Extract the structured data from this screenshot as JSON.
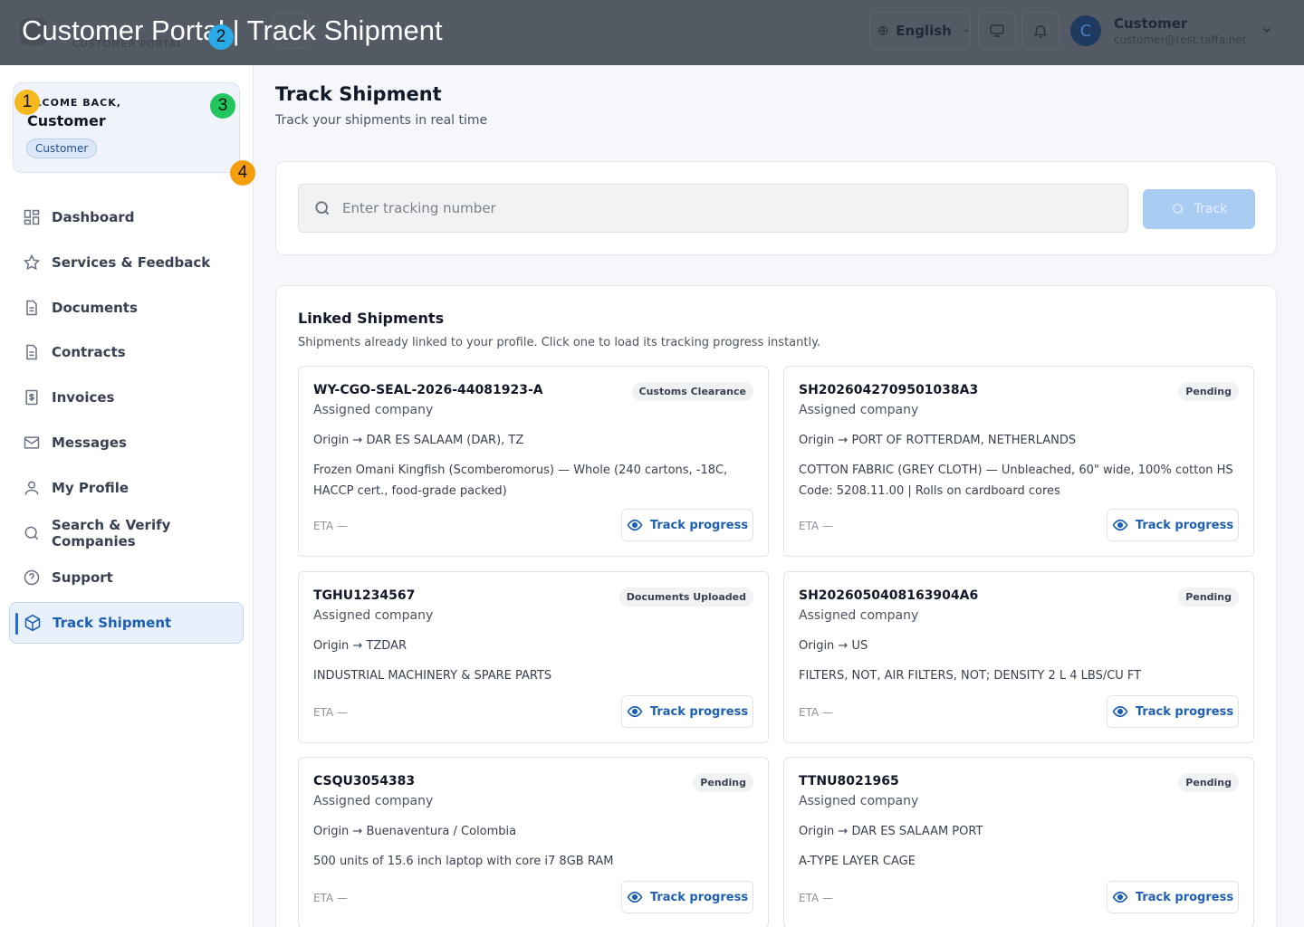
{
  "header": {
    "overlay_title": "Customer Portal | Track Shipment",
    "brand_sub": "CUSTOMER PORTAL",
    "language": "English",
    "user": {
      "initial": "C",
      "name": "Customer",
      "email": "customer@test.taffa.net"
    }
  },
  "sidebar": {
    "welcome_label": "ELCOME BACK,",
    "welcome_name": "Customer",
    "role": "Customer",
    "items": [
      {
        "label": "Dashboard",
        "icon": "dashboard-icon"
      },
      {
        "label": "Services & Feedback",
        "icon": "star-icon"
      },
      {
        "label": "Documents",
        "icon": "document-icon"
      },
      {
        "label": "Contracts",
        "icon": "document-icon"
      },
      {
        "label": "Invoices",
        "icon": "invoice-icon"
      },
      {
        "label": "Messages",
        "icon": "mail-icon"
      },
      {
        "label": "My Profile",
        "icon": "user-icon"
      },
      {
        "label": "Search & Verify Companies",
        "icon": "search-icon"
      },
      {
        "label": "Support",
        "icon": "help-icon"
      },
      {
        "label": "Track Shipment",
        "icon": "package-icon",
        "active": true
      }
    ]
  },
  "markers": [
    {
      "label": "1",
      "color": "#f5b91e"
    },
    {
      "label": "2",
      "color": "#2aa9e6"
    },
    {
      "label": "3",
      "color": "#22c55e"
    },
    {
      "label": "4",
      "color": "#f59e0b"
    }
  ],
  "main": {
    "title": "Track Shipment",
    "subtitle": "Track your shipments in real time",
    "search_placeholder": "Enter tracking number",
    "track_button": "Track",
    "linked_title": "Linked Shipments",
    "linked_subtitle": "Shipments already linked to your profile. Click one to load its tracking progress instantly.",
    "track_progress_label": "Track progress",
    "shipments": [
      {
        "id": "WY-CGO-SEAL-2026-44081923-A",
        "status": "Customs Clearance",
        "company": "Assigned company",
        "origin": "Origin → DAR ES SALAAM (DAR), TZ",
        "description": "Frozen Omani Kingfish (Scomberomorus) — Whole (240 cartons, -18C, HACCP cert., food-grade packed)",
        "eta": "ETA —"
      },
      {
        "id": "SH2026042709501038A3",
        "status": "Pending",
        "company": "Assigned company",
        "origin": "Origin → PORT OF ROTTERDAM, NETHERLANDS",
        "description": "COTTON FABRIC (GREY CLOTH) — Unbleached, 60\" wide, 100% cotton HS Code: 5208.11.00 | Rolls on cardboard cores",
        "eta": "ETA —"
      },
      {
        "id": "TGHU1234567",
        "status": "Documents Uploaded",
        "company": "Assigned company",
        "origin": "Origin → TZDAR",
        "description": "INDUSTRIAL MACHINERY & SPARE PARTS",
        "eta": "ETA —"
      },
      {
        "id": "SH2026050408163904A6",
        "status": "Pending",
        "company": "Assigned company",
        "origin": "Origin → US",
        "description": "FILTERS, NOT, AIR FILTERS, NOT; DENSITY 2 L 4 LBS/CU FT",
        "eta": "ETA —"
      },
      {
        "id": "CSQU3054383",
        "status": "Pending",
        "company": "Assigned company",
        "origin": "Origin → Buenaventura / Colombia",
        "description": "500 units of 15.6 inch laptop with core i7 8GB RAM",
        "eta": "ETA —"
      },
      {
        "id": "TTNU8021965",
        "status": "Pending",
        "company": "Assigned company",
        "origin": "Origin → DAR ES SALAAM PORT",
        "description": "A-TYPE LAYER CAGE",
        "eta": "ETA —"
      }
    ]
  }
}
